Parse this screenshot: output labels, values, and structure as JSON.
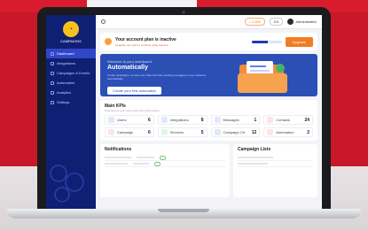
{
  "app": {
    "logo_text": "CAMPAIGNS"
  },
  "sidebar": {
    "items": [
      {
        "label": "Dashboard"
      },
      {
        "label": "Integrations"
      },
      {
        "label": "Campaigns & Events"
      },
      {
        "label": "Automation"
      },
      {
        "label": "Analytics"
      },
      {
        "label": "Settings"
      }
    ]
  },
  "topbar": {
    "credits": "• 1,000",
    "lang": "EN",
    "user": "Administrator"
  },
  "promo": {
    "title": "Your account plan is inactive",
    "subtitle": "Upgrade your plan to continue using features",
    "progress": 0.55,
    "button": "Upgrade"
  },
  "hero": {
    "kicker": "Welcome to your dashboard",
    "title": "Automatically",
    "description": "Create campaigns, connect your data and start sending messages to your audience automatically.",
    "button": "Create your first automation"
  },
  "kpis": {
    "title": "Main KPIs",
    "subtitle": "Overview of your current account performance",
    "items": [
      {
        "label": "Users",
        "value": "6",
        "color": "#dfe8fb"
      },
      {
        "label": "Integrations",
        "value": "8",
        "color": "#dfe8fb"
      },
      {
        "label": "Messages",
        "value": "1",
        "color": "#efe2fb"
      },
      {
        "label": "Contacts",
        "value": "24",
        "color": "#ffe2e2"
      },
      {
        "label": "Campaign",
        "value": "6",
        "color": "#ffe6e6"
      },
      {
        "label": "Services",
        "value": "5",
        "color": "#e1f6e6"
      },
      {
        "label": "Campaign Ctr",
        "value": "12",
        "color": "#dfe8fb"
      },
      {
        "label": "Automation",
        "value": "2",
        "color": "#ffe6e6"
      }
    ]
  },
  "notifications": {
    "title": "Notifications"
  },
  "campaigns": {
    "title": "Campaign Lists"
  }
}
